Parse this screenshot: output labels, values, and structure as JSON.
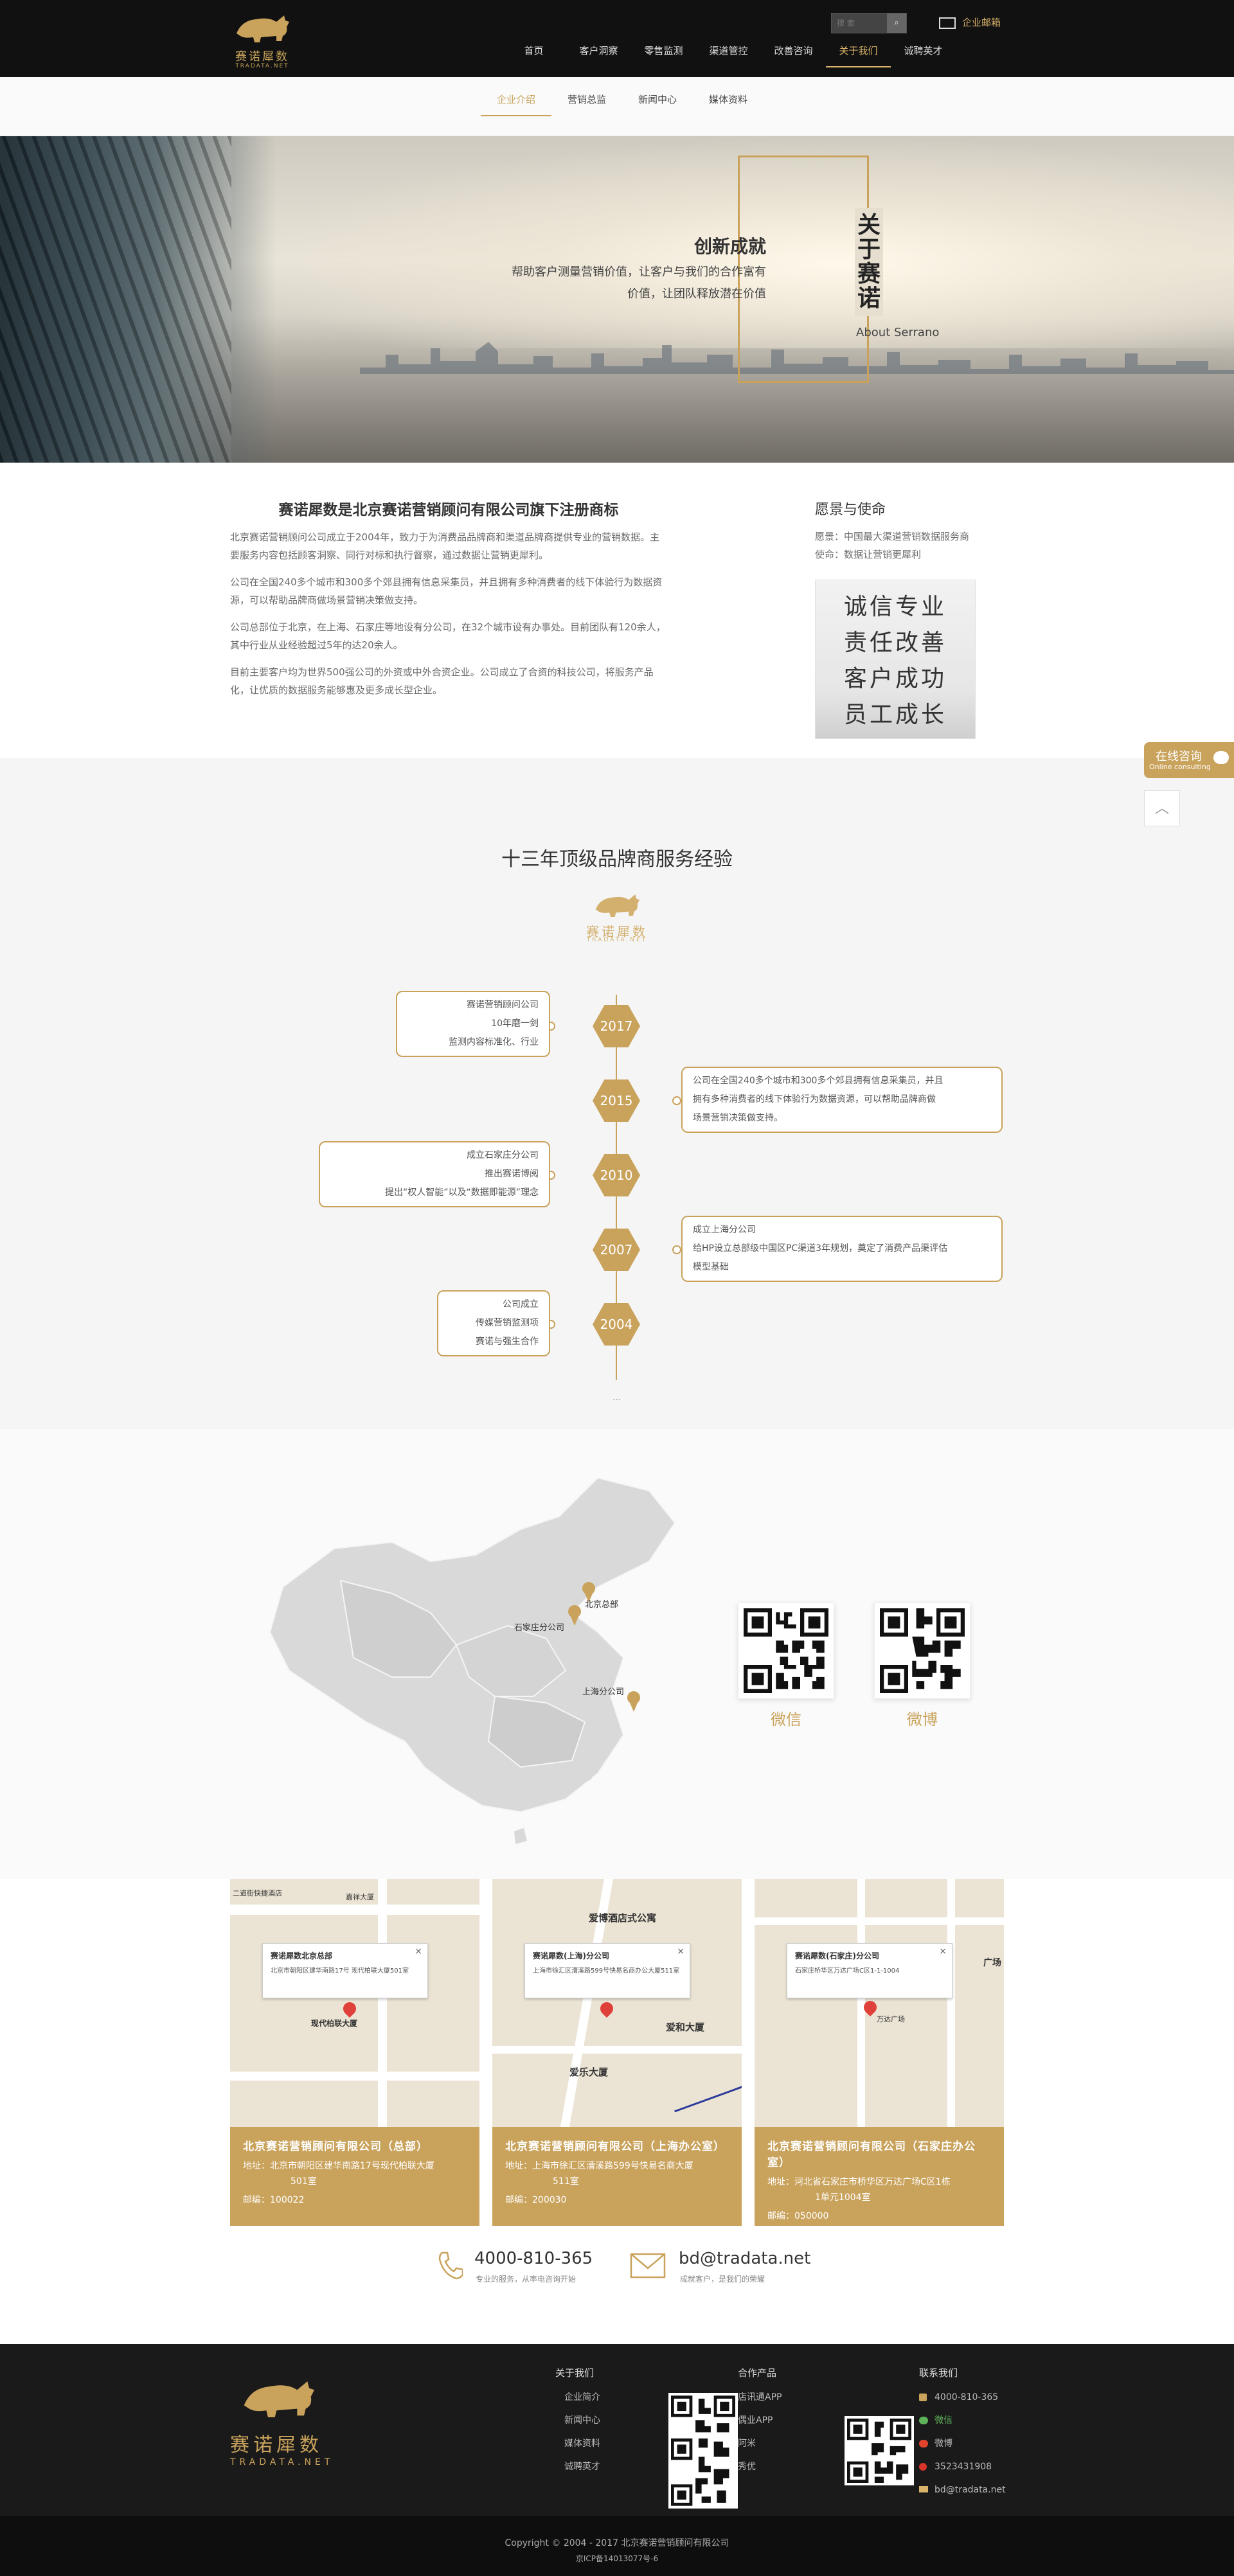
{
  "brand": {
    "name": "赛诺犀数",
    "name_en": "TRADATA.NET",
    "accent": "#c9a25b"
  },
  "header": {
    "search_placeholder": "搜 索",
    "mail_label": "企业邮箱",
    "nav": [
      "首页",
      "客户洞察",
      "零售监测",
      "渠道管控",
      "改善咨询",
      "关于我们",
      "诚聘英才"
    ],
    "nav_active": "关于我们"
  },
  "subnav": {
    "items": [
      "企业介绍",
      "营销总监",
      "新闻中心",
      "媒体资料"
    ],
    "active": "企业介绍"
  },
  "banner": {
    "title_cn": "关于赛诺",
    "title_en": "About Serrano",
    "heading": "创新成就",
    "line1": "帮助客户测量营销价值，让客户与我们的合作富有",
    "line2": "价值，让团队释放潜在价值"
  },
  "intro": {
    "heading": "赛诺犀数是北京赛诺营销顾问有限公司旗下注册商标",
    "paragraphs": [
      "北京赛诺营销顾问公司成立于2004年，致力于为消费品品牌商和渠道品牌商提供专业的营销数据。主要服务内容包括顾客洞察、同行对标和执行督察，通过数据让营销更犀利。",
      "公司在全国240多个城市和300多个郊县拥有信息采集员，并且拥有多种消费者的线下体验行为数据资源，可以帮助品牌商做场景营销决策做支持。",
      "公司总部位于北京，在上海、石家庄等地设有分公司，在32个城市设有办事处。目前团队有120余人，其中行业从业经验超过5年的达20余人。",
      "目前主要客户均为世界500强公司的外资或中外合资企业。公司成立了合资的科技公司，将服务产品化，让优质的数据服务能够惠及更多成长型企业。"
    ],
    "vision_title": "愿景与使命",
    "vision": "愿景：中国最大渠道营销数据服务商",
    "mission": "使命：数据让营销更犀利",
    "calligraphy": [
      "诚信专业",
      "责任改善",
      "客户成功",
      "员工成长"
    ]
  },
  "float": {
    "consult": "在线咨询",
    "consult_en": "Online consulting",
    "top": "︿"
  },
  "timeline": {
    "title": "十三年顶级品牌商服务经验",
    "more": "...",
    "events": [
      {
        "year": "2017",
        "side": "left",
        "lines": [
          "赛诺营销顾问公司",
          "10年磨一剑",
          "监测内容标准化、行业"
        ]
      },
      {
        "year": "2015",
        "side": "right",
        "lines": [
          "公司在全国240多个城市和300多个郊县拥有信息采集员，并且",
          "拥有多种消费者的线下体验行为数据资源，可以帮助品牌商做",
          "场景营销决策做支持。"
        ]
      },
      {
        "year": "2010",
        "side": "left",
        "lines": [
          "成立石家庄分公司",
          "推出赛诺博阅",
          "提出“权人智能”以及“数据即能源”理念"
        ]
      },
      {
        "year": "2007",
        "side": "right",
        "lines": [
          "成立上海分公司",
          "给HP设立总部级中国区PC渠道3年规划，奠定了消费产品渠评估",
          "模型基础"
        ]
      },
      {
        "year": "2004",
        "side": "left",
        "lines": [
          "公司成立",
          "传媒营销监测项",
          "赛诺与强生合作"
        ]
      }
    ]
  },
  "map": {
    "markers": [
      "北京总部",
      "石家庄分公司",
      "上海分公司"
    ],
    "qr": [
      {
        "label": "微信"
      },
      {
        "label": "微博"
      }
    ]
  },
  "offices": [
    {
      "name": "北京赛诺营销顾问有限公司（总部）",
      "addr1": "地址：北京市朝阳区建华南路17号现代柏联大厦",
      "addr2": "501室",
      "postcode": "邮编：100022",
      "popup_title": "赛诺犀数北京总部",
      "popup_addr": "北京市朝阳区建华南路17号 现代柏联大厦501室",
      "labels": [
        "二道街快捷酒店",
        "嘉祥大厦",
        "现代柏联大厦"
      ]
    },
    {
      "name": "北京赛诺营销顾问有限公司（上海办公室）",
      "addr1": "地址：上海市徐汇区漕溪路599号快易名商大厦",
      "addr2": "511室",
      "postcode": "邮编：200030",
      "popup_title": "赛诺犀数(上海)分公司",
      "popup_addr": "上海市徐汇区漕溪路599号快易名商办公大厦511室",
      "labels": [
        "爱博酒店式公寓",
        "爱和大厦",
        "爱乐大厦"
      ]
    },
    {
      "name": "北京赛诺营销顾问有限公司（石家庄办公室）",
      "addr1": "地址：河北省石家庄市桥华区万达广场C区1栋",
      "addr2": "1单元1004室",
      "postcode": "邮编：050000",
      "popup_title": "赛诺犀数(石家庄)分公司",
      "popup_addr": "石家庄桥华区万达广场C区1-1-1004",
      "labels": [
        "万达广场",
        "广场"
      ]
    }
  ],
  "contact": {
    "phone": "4000-810-365",
    "phone_sub": "专业的服务，从率电咨询开始",
    "email": "bd@tradata.net",
    "email_sub": "成就客户，是我们的荣耀"
  },
  "footer": {
    "about_title": "关于我们",
    "about": [
      "企业简介",
      "新闻中心",
      "媒体资料",
      "诚聘英才"
    ],
    "products_title": "合作产品",
    "products": [
      "店讯通APP",
      "偶业APP",
      "阿米",
      "秀优"
    ],
    "contact_title": "联系我们",
    "contact": [
      "4000-810-365",
      "微信",
      "微博",
      "3523431908",
      "bd@tradata.net"
    ],
    "copyright": "Copyright  ©  2004 - 2017  北京赛诺营销顾问有限公司",
    "icp": "京ICP备14013077号-6"
  }
}
